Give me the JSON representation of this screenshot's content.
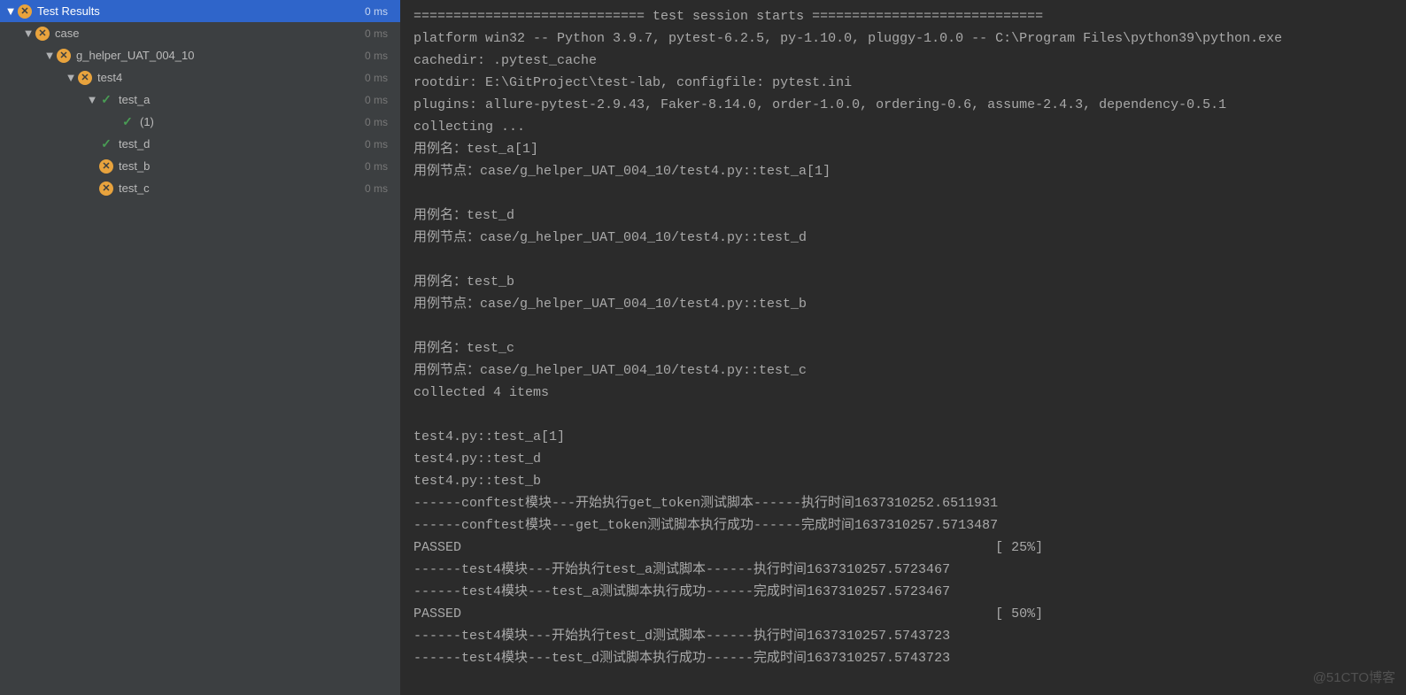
{
  "tree": {
    "root": {
      "label": "Test Results",
      "time": "0 ms",
      "status": "fail"
    },
    "items": [
      {
        "indent": 24,
        "chevron": true,
        "status": "fail",
        "label": "case",
        "time": "0 ms"
      },
      {
        "indent": 48,
        "chevron": true,
        "status": "fail",
        "label": "g_helper_UAT_004_10",
        "time": "0 ms"
      },
      {
        "indent": 72,
        "chevron": true,
        "status": "fail",
        "label": "test4",
        "time": "0 ms"
      },
      {
        "indent": 96,
        "chevron": true,
        "status": "pass",
        "label": "test_a",
        "time": "0 ms"
      },
      {
        "indent": 120,
        "chevron": false,
        "status": "pass",
        "label": "(1)",
        "time": "0 ms"
      },
      {
        "indent": 96,
        "chevron": false,
        "status": "pass",
        "label": "test_d",
        "time": "0 ms"
      },
      {
        "indent": 96,
        "chevron": false,
        "status": "fail",
        "label": "test_b",
        "time": "0 ms"
      },
      {
        "indent": 96,
        "chevron": false,
        "status": "fail",
        "label": "test_c",
        "time": "0 ms"
      }
    ]
  },
  "console_lines": [
    "============================= test session starts =============================",
    "platform win32 -- Python 3.9.7, pytest-6.2.5, py-1.10.0, pluggy-1.0.0 -- C:\\Program Files\\python39\\python.exe",
    "cachedir: .pytest_cache",
    "rootdir: E:\\GitProject\\test-lab, configfile: pytest.ini",
    "plugins: allure-pytest-2.9.43, Faker-8.14.0, order-1.0.0, ordering-0.6, assume-2.4.3, dependency-0.5.1",
    "collecting ...",
    "用例名：test_a[1]",
    "用例节点：case/g_helper_UAT_004_10/test4.py::test_a[1]",
    "",
    "用例名：test_d",
    "用例节点：case/g_helper_UAT_004_10/test4.py::test_d",
    "",
    "用例名：test_b",
    "用例节点：case/g_helper_UAT_004_10/test4.py::test_b",
    "",
    "用例名：test_c",
    "用例节点：case/g_helper_UAT_004_10/test4.py::test_c",
    "collected 4 items",
    "",
    "test4.py::test_a[1] ",
    "test4.py::test_d ",
    "test4.py::test_b ",
    "------conftest模块---开始执行get_token测试脚本------执行时间1637310252.6511931",
    "------conftest模块---get_token测试脚本执行成功------完成时间1637310257.5713487",
    "PASSED                                                                   [ 25%]",
    "------test4模块---开始执行test_a测试脚本------执行时间1637310257.5723467",
    "------test4模块---test_a测试脚本执行成功------完成时间1637310257.5723467",
    "PASSED                                                                   [ 50%]",
    "------test4模块---开始执行test_d测试脚本------执行时间1637310257.5743723",
    "------test4模块---test_d测试脚本执行成功------完成时间1637310257.5743723"
  ],
  "watermark": "@51CTO博客"
}
